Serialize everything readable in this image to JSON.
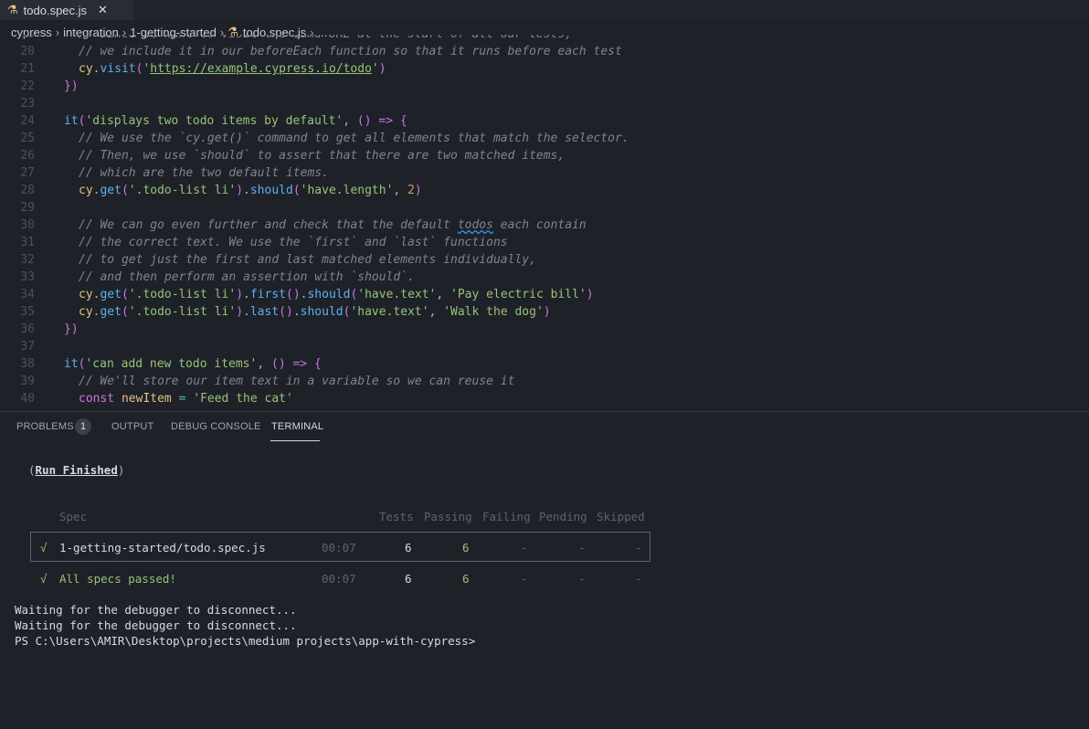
{
  "tab": {
    "title": "todo.spec.js",
    "close": "✕"
  },
  "breadcrumb": [
    "cypress",
    "integration",
    "1-getting-started",
    "todo.spec.js",
    "..."
  ],
  "editor_lines": [
    {
      "n": "19",
      "cls": "c",
      "t": "// Since we want to visit the same URL at the start of all our tests,"
    },
    {
      "n": "20",
      "cls": "c",
      "t": "// we include it in our beforeEach function so that it runs before each test"
    },
    {
      "n": "21",
      "t": "cy.visit('https://example.cypress.io/todo')"
    },
    {
      "n": "22",
      "t": "})"
    },
    {
      "n": "23",
      "t": ""
    },
    {
      "n": "24",
      "t": "it('displays two todo items by default', () => {"
    },
    {
      "n": "25",
      "cls": "c",
      "t": "// We use the `cy.get()` command to get all elements that match the selector."
    },
    {
      "n": "26",
      "cls": "c",
      "t": "// Then, we use `should` to assert that there are two matched items,"
    },
    {
      "n": "27",
      "cls": "c",
      "t": "// which are the two default items."
    },
    {
      "n": "28",
      "t": "cy.get('.todo-list li').should('have.length', 2)"
    },
    {
      "n": "29",
      "t": ""
    },
    {
      "n": "30",
      "cls": "c",
      "t": "// We can go even further and check that the default todos each contain"
    },
    {
      "n": "31",
      "cls": "c",
      "t": "// the correct text. We use the `first` and `last` functions"
    },
    {
      "n": "32",
      "cls": "c",
      "t": "// to get just the first and last matched elements individually,"
    },
    {
      "n": "33",
      "cls": "c",
      "t": "// and then perform an assertion with `should`."
    },
    {
      "n": "34",
      "t": "cy.get('.todo-list li').first().should('have.text', 'Pay electric bill')"
    },
    {
      "n": "35",
      "t": "cy.get('.todo-list li').last().should('have.text', 'Walk the dog')"
    },
    {
      "n": "36",
      "t": "})"
    },
    {
      "n": "37",
      "t": ""
    },
    {
      "n": "38",
      "t": "it('can add new todo items', () => {"
    },
    {
      "n": "39",
      "cls": "c",
      "t": "// We'll store our item text in a variable so we can reuse it"
    },
    {
      "n": "40",
      "t": "const newItem = 'Feed the cat'"
    }
  ],
  "panel": {
    "tabs": [
      "PROBLEMS",
      "OUTPUT",
      "DEBUG CONSOLE",
      "TERMINAL"
    ],
    "problems_count": "1"
  },
  "terminal": {
    "run_finished": "Run Finished",
    "headers": {
      "spec": "Spec",
      "tests": "Tests",
      "passing": "Passing",
      "failing": "Failing",
      "pending": "Pending",
      "skipped": "Skipped"
    },
    "rows": [
      {
        "check": "√",
        "spec": "1-getting-started/todo.spec.js",
        "time": "00:07",
        "tests": "6",
        "passing": "6",
        "failing": "-",
        "pending": "-",
        "skipped": "-"
      },
      {
        "check": "√",
        "spec": "All specs passed!",
        "time": "00:07",
        "tests": "6",
        "passing": "6",
        "failing": "-",
        "pending": "-",
        "skipped": "-"
      }
    ],
    "output": [
      "Waiting for the debugger to disconnect...",
      "Waiting for the debugger to disconnect...",
      "PS C:\\Users\\AMIR\\Desktop\\projects\\medium projects\\app-with-cypress>"
    ]
  }
}
